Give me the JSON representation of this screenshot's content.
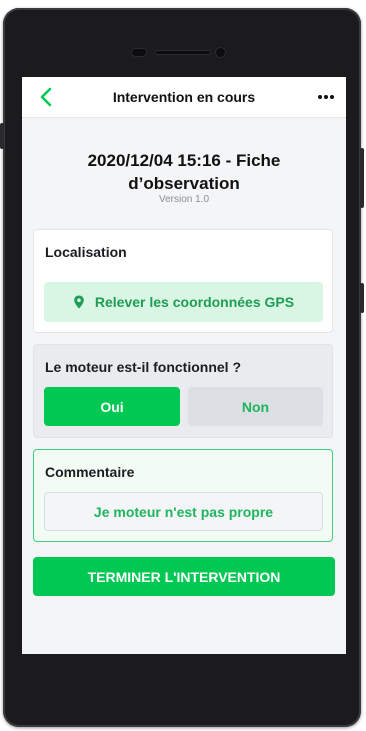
{
  "colors": {
    "accent": "#00c853",
    "accent_text": "#1fb55e",
    "phone_body": "#1b1b1d",
    "screen_bg": "#f4f5f7"
  },
  "header": {
    "title": "Intervention en cours",
    "back_icon": "chevron-left-icon",
    "menu_icon": "more-horizontal-icon"
  },
  "document": {
    "title": "2020/12/04 15:16 - Fiche d’observation",
    "version": "Version 1.0"
  },
  "location": {
    "label": "Localisation",
    "button_label": "Relever les coordonnées GPS",
    "button_icon": "map-pin-icon"
  },
  "motor": {
    "question": "Le moteur est-il fonctionnel ?",
    "options": [
      {
        "label": "Oui",
        "selected": true
      },
      {
        "label": "Non",
        "selected": false
      }
    ]
  },
  "comment": {
    "label": "Commentaire",
    "value": "Je moteur n'est pas propre"
  },
  "actions": {
    "finish_label": "TERMINER L'INTERVENTION"
  }
}
